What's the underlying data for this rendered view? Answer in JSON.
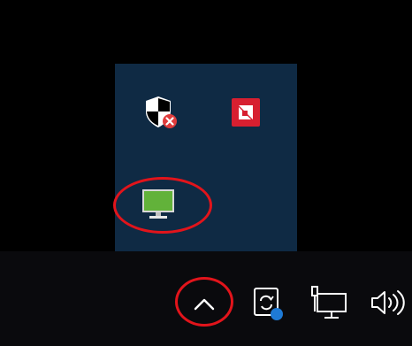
{
  "colors": {
    "desktop_background": "#000000",
    "flyout_background": "#0f2a44",
    "taskbar_background": "#0a0a0d",
    "highlight_ring": "#e2141b",
    "security_badge": "#e03c3c",
    "amd_red": "#d71f30",
    "monitor_green": "#62b23a",
    "sync_badge_blue": "#1e7ad6",
    "icon_white": "#ffffff"
  },
  "tray_flyout": {
    "icons": [
      "windows-security-warning-icon",
      "amd-software-icon",
      "display-monitor-icon"
    ]
  },
  "taskbar": {
    "tray_icons": [
      "chevron-up-icon",
      "sync-status-icon",
      "network-icon",
      "volume-icon"
    ]
  }
}
